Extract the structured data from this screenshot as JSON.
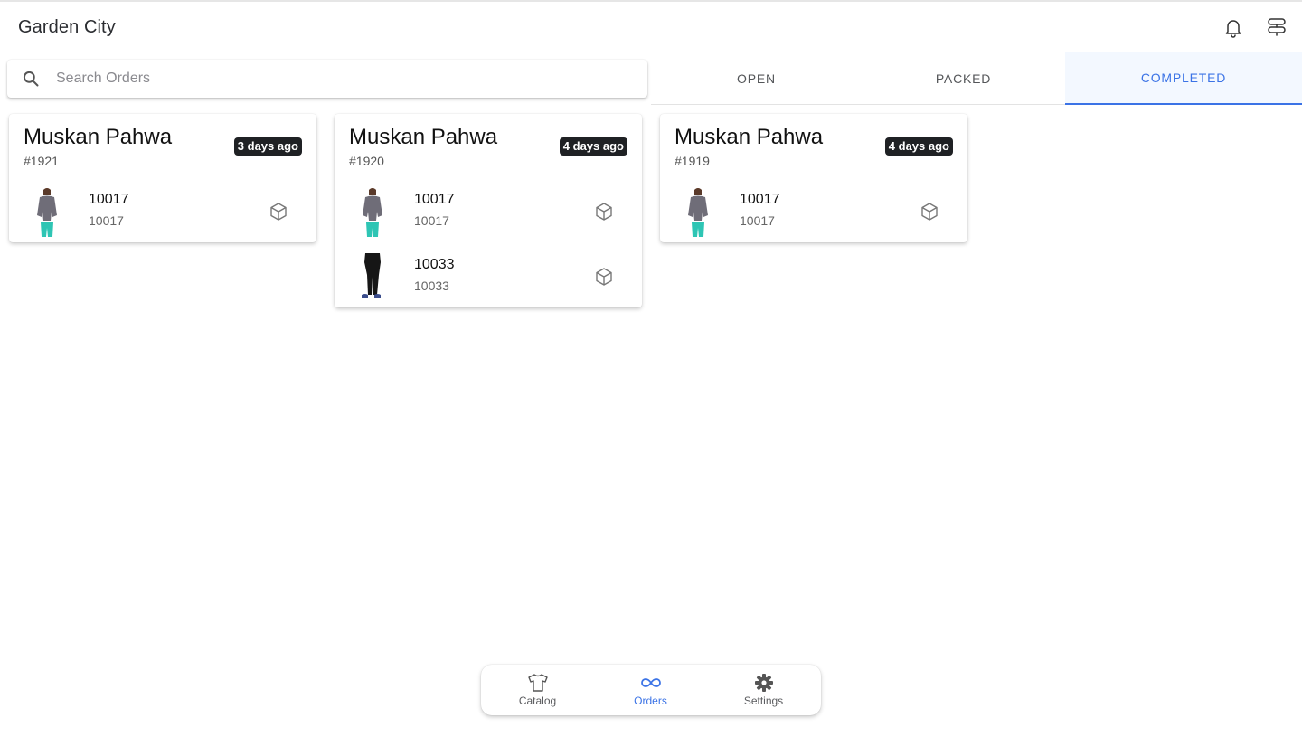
{
  "app": {
    "title": "Garden City"
  },
  "search": {
    "placeholder": "Search Orders",
    "value": ""
  },
  "tabs": [
    {
      "label": "OPEN",
      "active": false
    },
    {
      "label": "PACKED",
      "active": false
    },
    {
      "label": "COMPLETED",
      "active": true
    }
  ],
  "orders": [
    {
      "customer": "Muskan Pahwa",
      "id": "#1921",
      "age": "3 days ago",
      "items": [
        {
          "name": "10017",
          "sku": "10017",
          "image": "top"
        }
      ]
    },
    {
      "customer": "Muskan Pahwa",
      "id": "#1920",
      "age": "4 days ago",
      "items": [
        {
          "name": "10017",
          "sku": "10017",
          "image": "top"
        },
        {
          "name": "10033",
          "sku": "10033",
          "image": "leggings"
        }
      ]
    },
    {
      "customer": "Muskan Pahwa",
      "id": "#1919",
      "age": "4 days ago",
      "items": [
        {
          "name": "10017",
          "sku": "10017",
          "image": "top"
        }
      ]
    }
  ],
  "bottom_nav": [
    {
      "label": "Catalog",
      "icon": "shirt-icon",
      "active": false
    },
    {
      "label": "Orders",
      "icon": "infinity-icon",
      "active": true
    },
    {
      "label": "Settings",
      "icon": "gear-icon",
      "active": false
    }
  ],
  "colors": {
    "accent": "#3b73e6",
    "badge": "#1f2124",
    "tab_active_bg": "#f3f8ff"
  }
}
